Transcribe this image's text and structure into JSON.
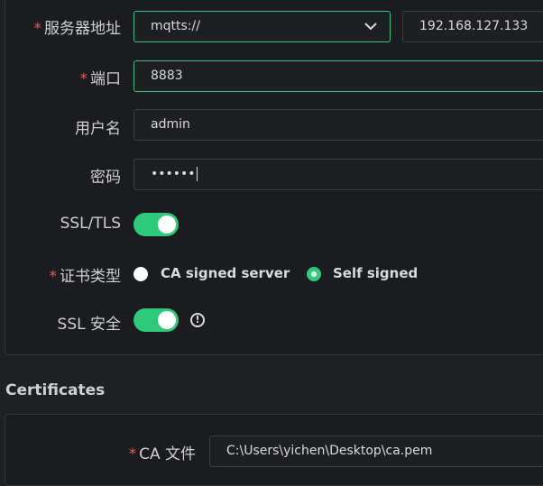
{
  "form": {
    "server_address": {
      "label": "服务器地址",
      "protocol": "mqtts://",
      "host": "192.168.127.133"
    },
    "port": {
      "label": "端口",
      "value": "8883"
    },
    "username": {
      "label": "用户名",
      "value": "admin"
    },
    "password": {
      "label": "密码",
      "value": "••••••"
    },
    "ssl_tls": {
      "label": "SSL/TLS",
      "enabled": true
    },
    "cert_type": {
      "label": "证书类型",
      "options": [
        "CA signed server",
        "Self signed"
      ],
      "selected": "Self signed"
    },
    "ssl_secure": {
      "label": "SSL 安全",
      "enabled": true
    }
  },
  "certificates": {
    "title": "Certificates",
    "ca_file": {
      "label": "CA 文件",
      "value": "C:\\Users\\yichen\\Desktop\\ca.pem"
    }
  },
  "required_mark": "*",
  "info_glyph": "!",
  "colors": {
    "accent": "#2fc97a",
    "required": "#e25b5b",
    "background": "#1b1c20"
  }
}
